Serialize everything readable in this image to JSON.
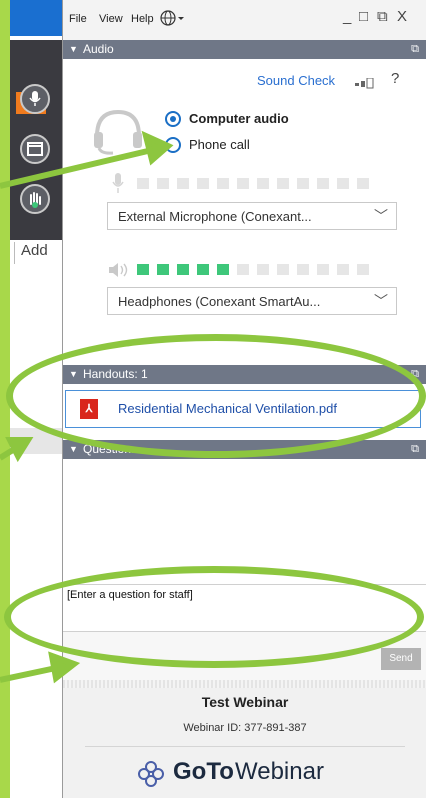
{
  "colors": {
    "slide_bg": "#a8d84a",
    "accent_green": "#8dc63f",
    "section_header": "#6f7787",
    "link_blue": "#2a6fd0",
    "level_on": "#3ec77a",
    "pdf_red": "#d9261c"
  },
  "background_app": {
    "add_label": "Add",
    "arrow_icon": "arrow-right-icon"
  },
  "menubar": {
    "file": "File",
    "view": "View",
    "help": "Help",
    "globe_icon": "globe-icon",
    "min": "_",
    "restore": "□",
    "popout": "⧉",
    "close": "X"
  },
  "audio": {
    "header": "Audio",
    "sound_check": "Sound Check",
    "help": "?",
    "options": [
      {
        "label": "Computer audio",
        "selected": true
      },
      {
        "label": "Phone call",
        "selected": false
      }
    ],
    "mic_level_on": 0,
    "speaker_level_on": 5,
    "level_total": 12,
    "mic_device": "External Microphone (Conexant...",
    "speaker_device": "Headphones (Conexant SmartAu..."
  },
  "handouts": {
    "header": "Handouts: 1",
    "items": [
      {
        "name": "Residential Mechanical Ventilation.pdf",
        "icon": "pdf-icon"
      }
    ]
  },
  "questions": {
    "header": "Questions",
    "placeholder": "[Enter a question for staff]",
    "send_label": "Send"
  },
  "footer": {
    "title": "Test Webinar",
    "webinar_id": "Webinar ID: 377-891-387",
    "logo_goto": "GoTo",
    "logo_product": "Webinar"
  }
}
